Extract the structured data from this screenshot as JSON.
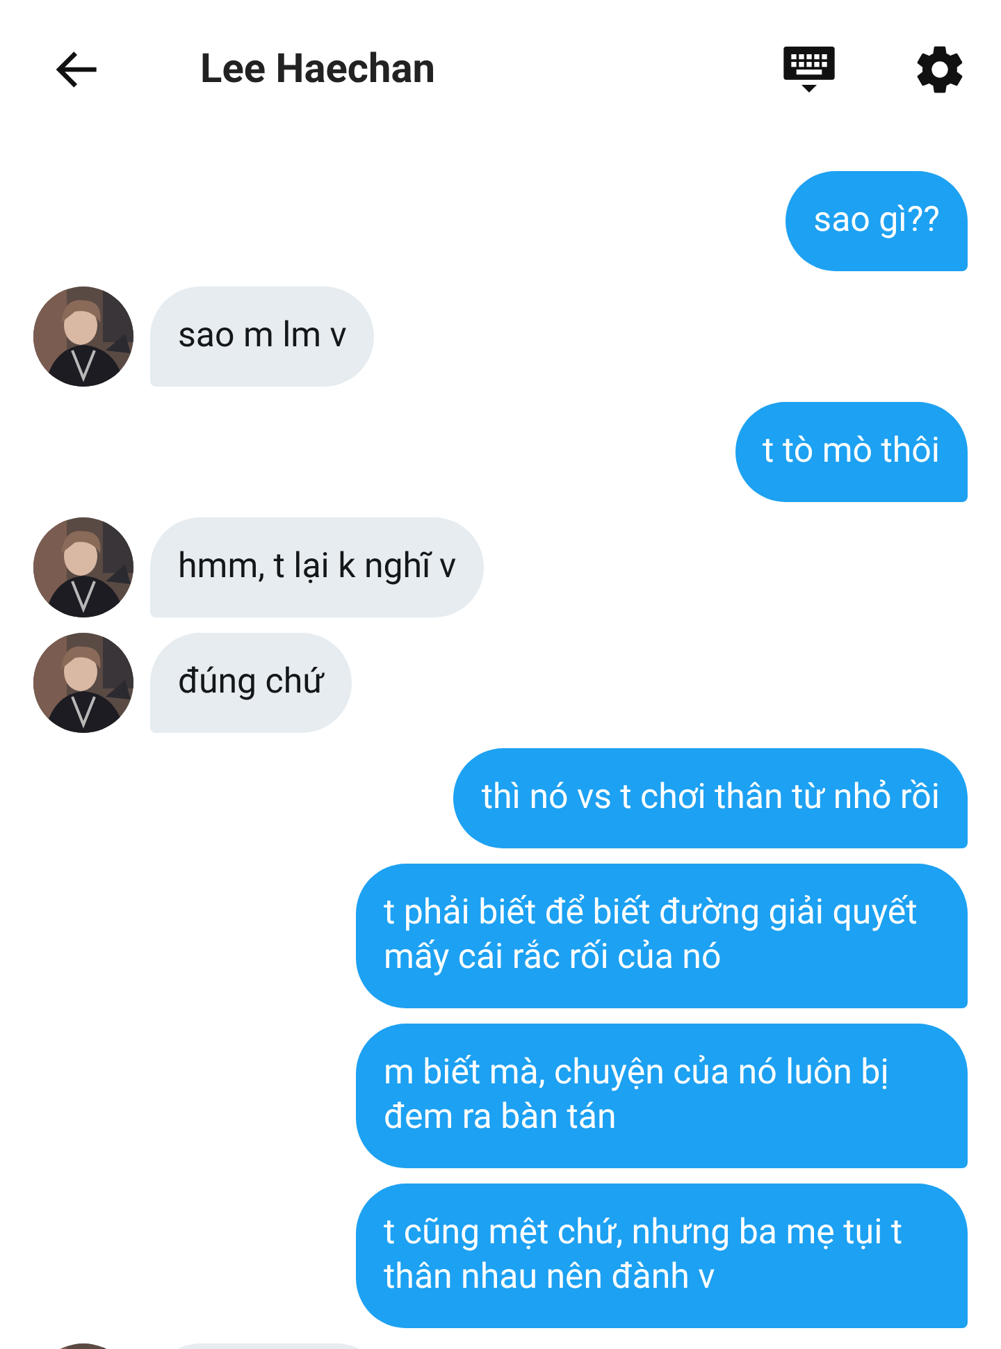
{
  "header": {
    "title": "Lee Haechan"
  },
  "messages": [
    {
      "kind": "sent",
      "text": "sao gì??"
    },
    {
      "kind": "received",
      "text": "sao m lm v"
    },
    {
      "kind": "sent",
      "text": "t tò mò thôi"
    },
    {
      "kind": "received",
      "text": "hmm, t lại k nghĩ v"
    },
    {
      "kind": "received",
      "text": "đúng chứ"
    },
    {
      "kind": "sent",
      "text": "thì nó vs t chơi thân từ nhỏ rồi"
    },
    {
      "kind": "sent",
      "text": "t phải biết để biết đường giải quyết mấy cái rắc rối của nó"
    },
    {
      "kind": "sent",
      "text": "m biết mà, chuyện của nó luôn bị đem ra bàn tán"
    },
    {
      "kind": "sent",
      "text": "t cũng mệt chứ, nhưng ba mẹ tụi t thân nhau nên đành v"
    },
    {
      "kind": "received"
    }
  ]
}
